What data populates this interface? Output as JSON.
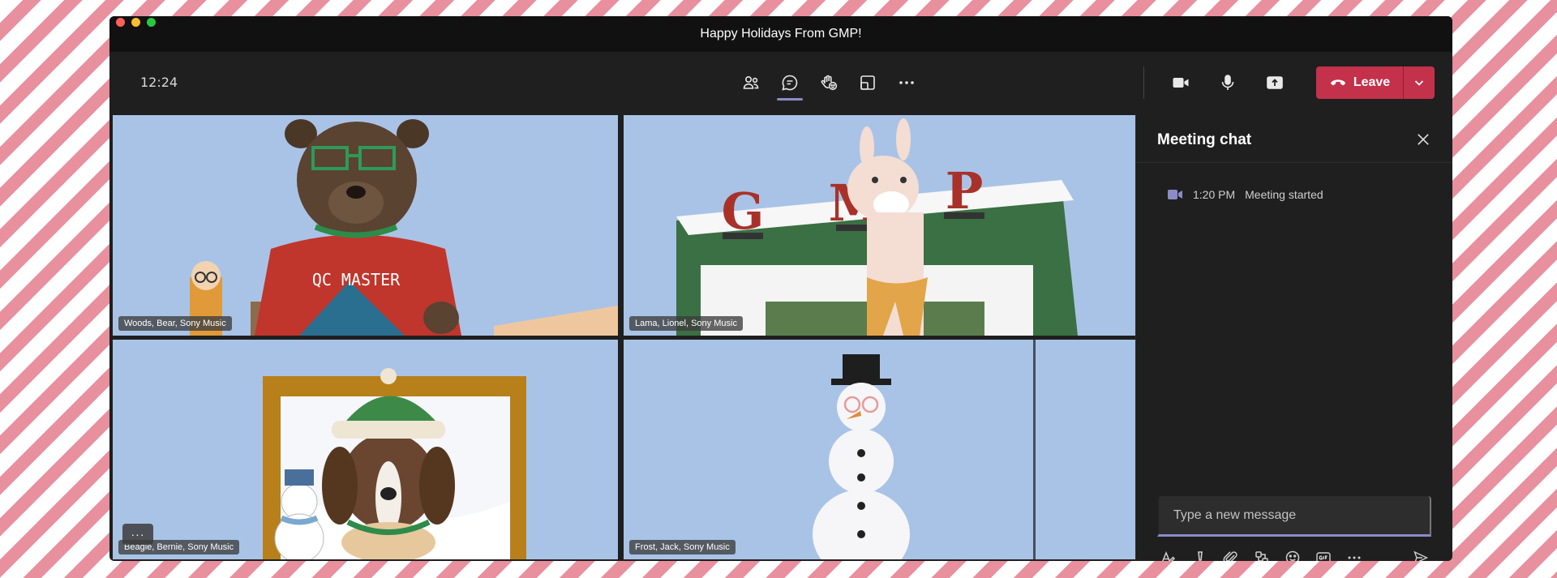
{
  "window": {
    "title": "Happy Holidays From GMP!",
    "traffic_lights": [
      "#ff5f57",
      "#febc2e",
      "#28c840"
    ]
  },
  "toolbar": {
    "clock": "12:24",
    "icons": [
      "people-icon",
      "chat-icon",
      "raise-hand-icon",
      "rooms-icon",
      "more-icon",
      "camera-icon",
      "mic-icon",
      "share-icon"
    ],
    "leave_label": "Leave",
    "leave_color": "#c4314b",
    "active_underline_color": "#8b8cc7"
  },
  "participants": [
    {
      "name": "Woods, Bear, Sony Music"
    },
    {
      "name": "Lama, Lionel, Sony Music"
    },
    {
      "name": "Beagle, Bernie, Sony Music"
    },
    {
      "name": "Frost, Jack, Sony Music"
    }
  ],
  "tile_texts": {
    "sweater": "QC MASTER",
    "sign_letters": [
      "G",
      "M",
      "P"
    ]
  },
  "more_overlay": "···",
  "chat": {
    "title": "Meeting chat",
    "events": [
      {
        "time": "1:20 PM",
        "text": "Meeting started"
      }
    ],
    "composer_placeholder": "Type a new message",
    "composer_icons": [
      "format-icon",
      "important-icon",
      "attach-icon",
      "loop-icon",
      "emoji-icon",
      "gif-icon",
      "more-options-icon",
      "send-icon"
    ],
    "accent_color": "#8b8cc7"
  }
}
